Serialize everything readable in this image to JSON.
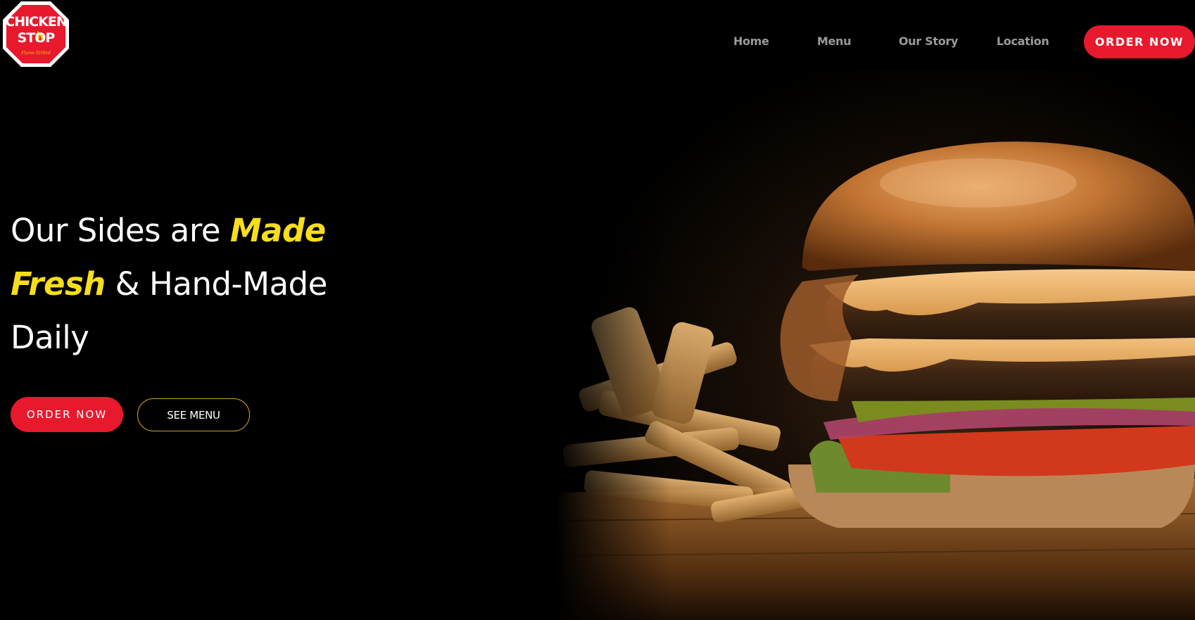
{
  "brand": {
    "logo_line1": "CHICKEN",
    "logo_line2": "STOP",
    "logo_tagline": "Flame Grilled",
    "red": "#e8192c",
    "yellow": "#f7dd1b"
  },
  "nav": {
    "items": [
      {
        "label": "Home"
      },
      {
        "label": "Menu"
      },
      {
        "label": "Our Story"
      },
      {
        "label": "Location"
      }
    ],
    "cta_label": "ORDER NOW"
  },
  "hero": {
    "headline_part1": "Our Sides are ",
    "headline_accent1": "Made",
    "headline_accent2": "Fresh",
    "headline_part2": " & Hand-Made",
    "headline_part3": "Daily",
    "primary_button": "ORDER NOW",
    "secondary_button": "SEE MENU",
    "image_subject": "double cheeseburger with fries"
  }
}
